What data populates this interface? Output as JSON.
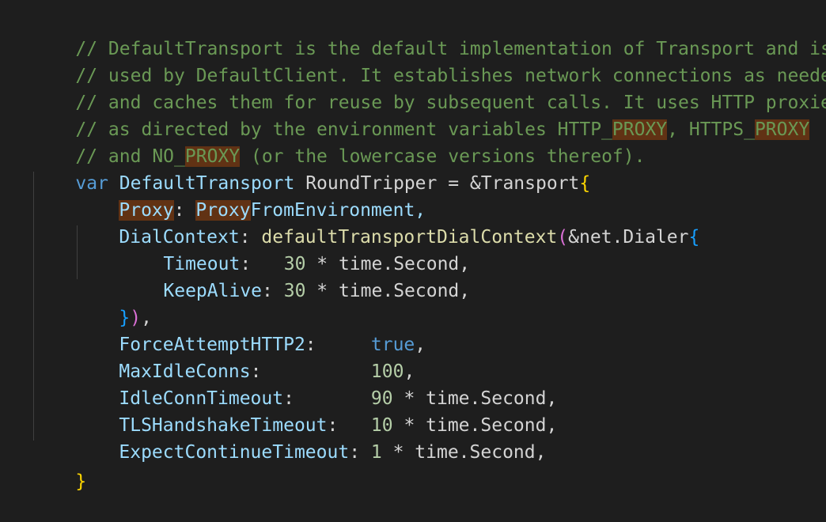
{
  "editor": {
    "language": "Go",
    "theme": {
      "background": "#1e1e1e",
      "comment": "#6a9955",
      "keyword": "#569cd6",
      "variable": "#9cdcfe",
      "function": "#dcdcaa",
      "number": "#b5cea8",
      "text": "#d4d4d4",
      "bracket_level1": "#ffd700",
      "bracket_level2": "#da70d6",
      "bracket_level3": "#179fff",
      "find_match_highlight": "#613214"
    },
    "highlighted_term": "PROXY",
    "comment_lines": {
      "l1": "// DefaultTransport is the default implementation of Transport and is",
      "l2": "// used by DefaultClient. It establishes network connections as needed",
      "l3": "// and caches them for reuse by subsequent calls. It uses HTTP proxies",
      "l4a": "// as directed by the environment variables HTTP_",
      "l4b": "PROXY",
      "l4c": ", HTTPS_",
      "l4d": "PROXY",
      "l5a": "// and NO_",
      "l5b": "PROXY",
      "l5c": " (or the lowercase versions thereof)."
    },
    "code": {
      "var_kw": "var",
      "var_name": "DefaultTransport",
      "var_type": " RoundTripper = &Transport",
      "open_brace": "{",
      "proxy_field": "Proxy",
      "colon_space": ": ",
      "proxy_value_hl": "Proxy",
      "proxy_value_rest": "FromEnvironment,",
      "dialcontext_field": "DialContext",
      "dialcontext_fn": "defaultTransportDialContext",
      "open_paren": "(",
      "dialer_type": "&net.Dialer",
      "timeout_field": "Timeout",
      "timeout_pad": ":   ",
      "keepalive_field": "KeepAlive",
      "keepalive_pad": ": ",
      "thirty": "30",
      "times_second": " * time.Second,",
      "close_brace_inner": "}",
      "close_paren": ")",
      "trailing_comma": ",",
      "force_field": "ForceAttemptHTTP2",
      "force_pad": ":     ",
      "force_value": "true",
      "maxidle_field": "MaxIdleConns",
      "maxidle_pad": ":          ",
      "maxidle_value": "100",
      "idletimeout_field": "IdleConnTimeout",
      "idletimeout_pad": ":       ",
      "idletimeout_value": "90",
      "tls_field": "TLSHandshakeTimeout",
      "tls_pad": ":   ",
      "tls_value": "10",
      "expect_field": "ExpectContinueTimeout",
      "expect_pad": ": ",
      "expect_value": "1",
      "close_brace_outer": "}"
    }
  }
}
